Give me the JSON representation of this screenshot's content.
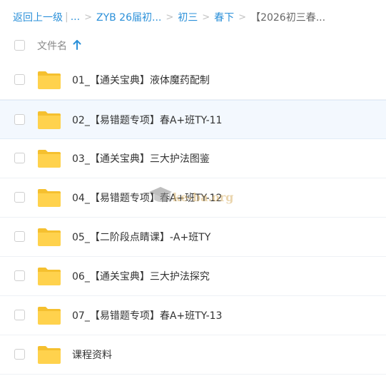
{
  "breadcrumb": {
    "back": "返回上一级",
    "pipe": "|",
    "ellipsis": "...",
    "items": [
      "ZYB 26届初...",
      "初三",
      "春下"
    ],
    "current": "【2026初三春..."
  },
  "header": {
    "column_label": "文件名",
    "sort_icon": "arrow-up-icon"
  },
  "files": [
    {
      "name": "01_【通关宝典】液体魔药配制",
      "type": "folder"
    },
    {
      "name": "02_【易错题专项】春A+班TY-11",
      "type": "folder"
    },
    {
      "name": "03_【通关宝典】三大护法图鉴",
      "type": "folder"
    },
    {
      "name": "04_【易错题专项】春A+班TY-12",
      "type": "folder"
    },
    {
      "name": "05_【二阶段点睛课】-A+班TY",
      "type": "folder"
    },
    {
      "name": "06_【通关宝典】三大护法探究",
      "type": "folder"
    },
    {
      "name": "07_【易错题专项】春A+班TY-13",
      "type": "folder"
    },
    {
      "name": "课程资料",
      "type": "folder"
    }
  ],
  "selected_row": 1,
  "watermark": {
    "text": "ke-ba.org"
  },
  "colors": {
    "link": "#2b90d9",
    "folder": "#ffd24d",
    "folder_tab": "#f5c02f",
    "row_highlight": "#f3f8fe"
  }
}
